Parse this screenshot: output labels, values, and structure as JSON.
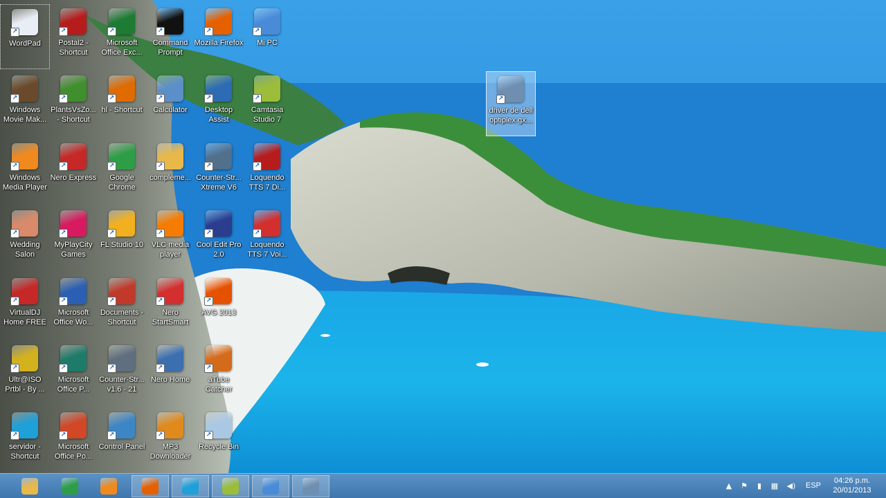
{
  "desktop_icons": [
    {
      "label": "WordPad",
      "icon": "wordpad-icon",
      "color": "#e9eef6"
    },
    {
      "label": "Postal2 - Shortcut",
      "icon": "postal2-icon",
      "color": "#b71c1c"
    },
    {
      "label": "Microsoft Office Exc...",
      "icon": "excel-icon",
      "color": "#1e7b34"
    },
    {
      "label": "Command Prompt",
      "icon": "cmd-icon",
      "color": "#111111"
    },
    {
      "label": "Mozilla Firefox",
      "icon": "firefox-icon",
      "color": "#e66000"
    },
    {
      "label": "Mi PC",
      "icon": "computer-icon",
      "color": "#4a8bd8"
    },
    {
      "label": "Windows Movie Mak...",
      "icon": "movie-maker-icon",
      "color": "#6b4a2b"
    },
    {
      "label": "PlantsVsZo... - Shortcut",
      "icon": "plants-vs-zombies-icon",
      "color": "#3f8f2c"
    },
    {
      "label": "hl - Shortcut",
      "icon": "half-life-icon",
      "color": "#e06b00"
    },
    {
      "label": "Calculator",
      "icon": "calculator-icon",
      "color": "#5b8fc9"
    },
    {
      "label": "Desktop Assist",
      "icon": "desktop-assist-icon",
      "color": "#2d6bb5"
    },
    {
      "label": "Camtasia Studio 7",
      "icon": "camtasia-icon",
      "color": "#9bbd3a"
    },
    {
      "label": "Windows Media Player",
      "icon": "media-player-icon",
      "color": "#f08a1e"
    },
    {
      "label": "Nero Express",
      "icon": "nero-express-icon",
      "color": "#c62828"
    },
    {
      "label": "Google Chrome",
      "icon": "chrome-icon",
      "color": "#2e9e46"
    },
    {
      "label": "compleme...",
      "icon": "folder-icon",
      "color": "#e8b84a"
    },
    {
      "label": "Counter-Str... Xtreme V6",
      "icon": "counter-strike-icon",
      "color": "#51708c"
    },
    {
      "label": "Loquendo TTS 7 Di...",
      "icon": "loquendo-director-icon",
      "color": "#b71c1c"
    },
    {
      "label": "Wedding Salon",
      "icon": "wedding-salon-icon",
      "color": "#d98a6a"
    },
    {
      "label": "MyPlayCity Games",
      "icon": "myplaycity-icon",
      "color": "#d81b60"
    },
    {
      "label": "FL Studio 10",
      "icon": "fl-studio-icon",
      "color": "#f2b01e"
    },
    {
      "label": "VLC media player",
      "icon": "vlc-icon",
      "color": "#f57c00"
    },
    {
      "label": "Cool Edit Pro 2.0",
      "icon": "cool-edit-icon",
      "color": "#2a3d8f"
    },
    {
      "label": "Loquendo TTS 7 Voi...",
      "icon": "loquendo-voice-icon",
      "color": "#d32f2f"
    },
    {
      "label": "VirtualDJ Home FREE",
      "icon": "virtualdj-icon",
      "color": "#c62828"
    },
    {
      "label": "Microsoft Office Wo...",
      "icon": "word-icon",
      "color": "#2b5fb3"
    },
    {
      "label": "Documents - Shortcut",
      "icon": "documents-icon",
      "color": "#c0392b"
    },
    {
      "label": "Nero StartSmart",
      "icon": "nero-startsmart-icon",
      "color": "#d32f2f"
    },
    {
      "label": "AVG 2013",
      "icon": "avg-icon",
      "color": "#e65100"
    },
    {
      "label": "Ultr@ISO Prtbl - By ...",
      "icon": "ultraiso-icon",
      "color": "#d4b21e"
    },
    {
      "label": "Microsoft Office P...",
      "icon": "publisher-icon",
      "color": "#1e7b6a"
    },
    {
      "label": "Counter-Str... v1.6 - 21",
      "icon": "counter-strike-16-icon",
      "color": "#5f6f7f"
    },
    {
      "label": "Nero Home",
      "icon": "nero-home-icon",
      "color": "#3b6fb0"
    },
    {
      "label": "aTube Catcher",
      "icon": "atube-catcher-icon",
      "color": "#d46a1a"
    },
    {
      "label": "servidor - Shortcut",
      "icon": "clock-icon",
      "color": "#1ea0d8"
    },
    {
      "label": "Microsoft Office Po...",
      "icon": "powerpoint-icon",
      "color": "#d24726"
    },
    {
      "label": "Control Panel",
      "icon": "control-panel-icon",
      "color": "#3d86c6"
    },
    {
      "label": "MP3 Downloader",
      "icon": "mp3-downloader-icon",
      "color": "#e08a1e"
    },
    {
      "label": "Recycle Bin",
      "icon": "recycle-bin-icon",
      "color": "#a9c8e4"
    },
    {
      "label": "driver de dell optiplex gx...",
      "icon": "installer-icon",
      "color": "#6f8fb0"
    }
  ],
  "taskbar": {
    "items": [
      {
        "icon": "file-explorer-icon",
        "color": "#e8b84a"
      },
      {
        "icon": "chrome-icon",
        "color": "#2e9e46"
      },
      {
        "icon": "media-player-icon",
        "color": "#f08a1e"
      },
      {
        "icon": "firefox-icon",
        "color": "#e66000"
      },
      {
        "icon": "clock-icon",
        "color": "#1ea0d8"
      },
      {
        "icon": "camtasia-icon",
        "color": "#9bbd3a"
      },
      {
        "icon": "window-icon",
        "color": "#4a8bd8"
      },
      {
        "icon": "installer-icon",
        "color": "#6f8fb0"
      }
    ],
    "language": "ESP",
    "time": "04:26 p.m.",
    "date": "20/01/2013"
  }
}
